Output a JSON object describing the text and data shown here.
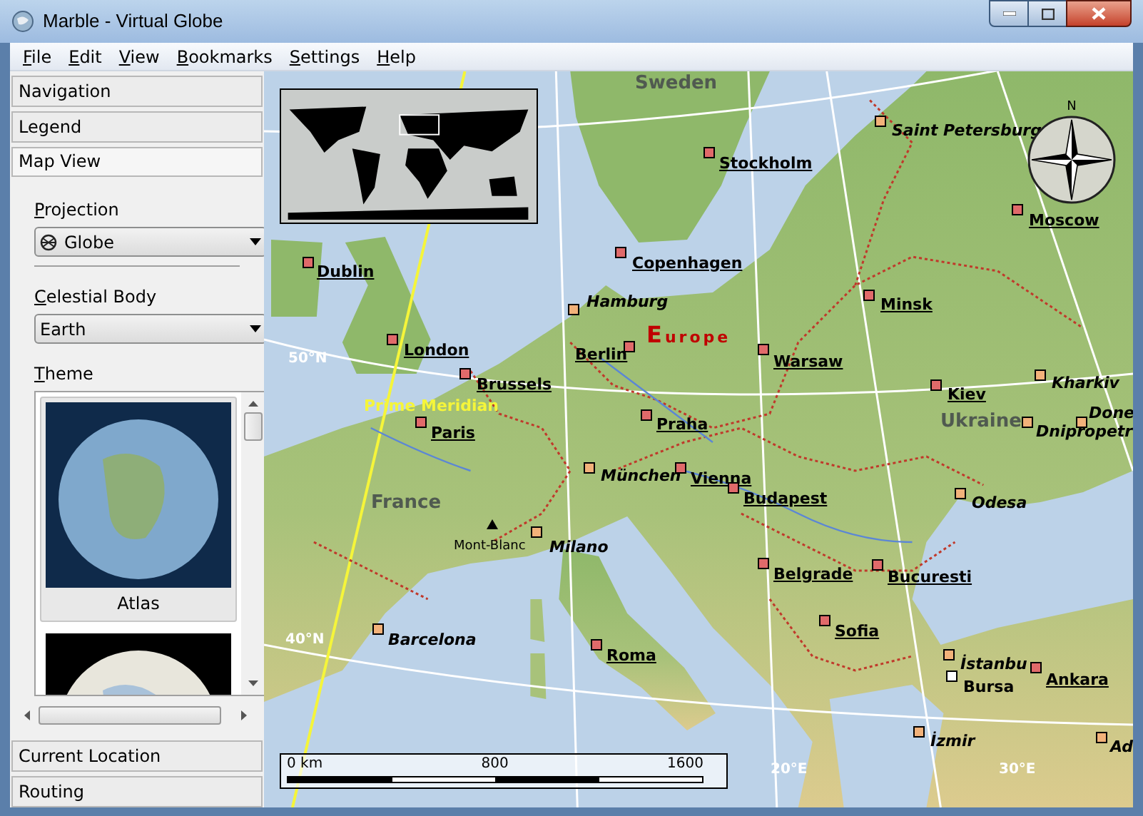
{
  "window": {
    "title": "Marble - Virtual Globe"
  },
  "menu": [
    "File",
    "Edit",
    "View",
    "Bookmarks",
    "Settings",
    "Help"
  ],
  "toolbox": [
    {
      "label": "Navigation",
      "expanded": false
    },
    {
      "label": "Legend",
      "expanded": false
    },
    {
      "label": "Map View",
      "expanded": true
    },
    {
      "label": "Current Location",
      "expanded": false
    },
    {
      "label": "Routing",
      "expanded": false
    }
  ],
  "map_view": {
    "projection": {
      "label": "Projection",
      "value": "Globe"
    },
    "celestial_body": {
      "label": "Celestial Body",
      "value": "Earth"
    },
    "theme": {
      "label": "Theme",
      "items": [
        {
          "name": "Atlas",
          "selected": true
        },
        {
          "selected": false
        }
      ]
    }
  },
  "map": {
    "countries": [
      "Sweden",
      "France",
      "Ukraine"
    ],
    "continent": "Europe",
    "meridian_label": "Prime Meridian",
    "grid_labels": [
      "50°N",
      "40°N",
      "20°E",
      "30°E"
    ],
    "places": [
      {
        "name": "Saint Petersburg",
        "kind": "city"
      },
      {
        "name": "Stockholm",
        "kind": "capital"
      },
      {
        "name": "Moscow",
        "kind": "capital"
      },
      {
        "name": "Dublin",
        "kind": "capital"
      },
      {
        "name": "Copenhagen",
        "kind": "capital"
      },
      {
        "name": "Hamburg",
        "kind": "city"
      },
      {
        "name": "Minsk",
        "kind": "capital"
      },
      {
        "name": "London",
        "kind": "capital"
      },
      {
        "name": "Berlin",
        "kind": "capital"
      },
      {
        "name": "Warsaw",
        "kind": "capital"
      },
      {
        "name": "Brussels",
        "kind": "capital"
      },
      {
        "name": "Kiev",
        "kind": "capital"
      },
      {
        "name": "Kharkiv",
        "kind": "city"
      },
      {
        "name": "Paris",
        "kind": "capital"
      },
      {
        "name": "Praha",
        "kind": "capital"
      },
      {
        "name": "Done",
        "kind": "city"
      },
      {
        "name": "Dnipropetr",
        "kind": "city"
      },
      {
        "name": "München",
        "kind": "city"
      },
      {
        "name": "Vienna",
        "kind": "capital"
      },
      {
        "name": "Budapest",
        "kind": "capital"
      },
      {
        "name": "Odesa",
        "kind": "city"
      },
      {
        "name": "Mont-Blanc",
        "kind": "peak"
      },
      {
        "name": "Milano",
        "kind": "city"
      },
      {
        "name": "Belgrade",
        "kind": "capital"
      },
      {
        "name": "Bucuresti",
        "kind": "capital"
      },
      {
        "name": "Barcelona",
        "kind": "city"
      },
      {
        "name": "Sofia",
        "kind": "capital"
      },
      {
        "name": "Roma",
        "kind": "capital"
      },
      {
        "name": "İstanbu",
        "kind": "city"
      },
      {
        "name": "Bursa",
        "kind": "town"
      },
      {
        "name": "Ankara",
        "kind": "capital"
      },
      {
        "name": "İzmir",
        "kind": "city"
      },
      {
        "name": "Ad",
        "kind": "city"
      }
    ],
    "scale_bar": {
      "ticks": [
        "0 km",
        "800",
        "1600"
      ]
    },
    "compass": {
      "north": "N"
    }
  }
}
